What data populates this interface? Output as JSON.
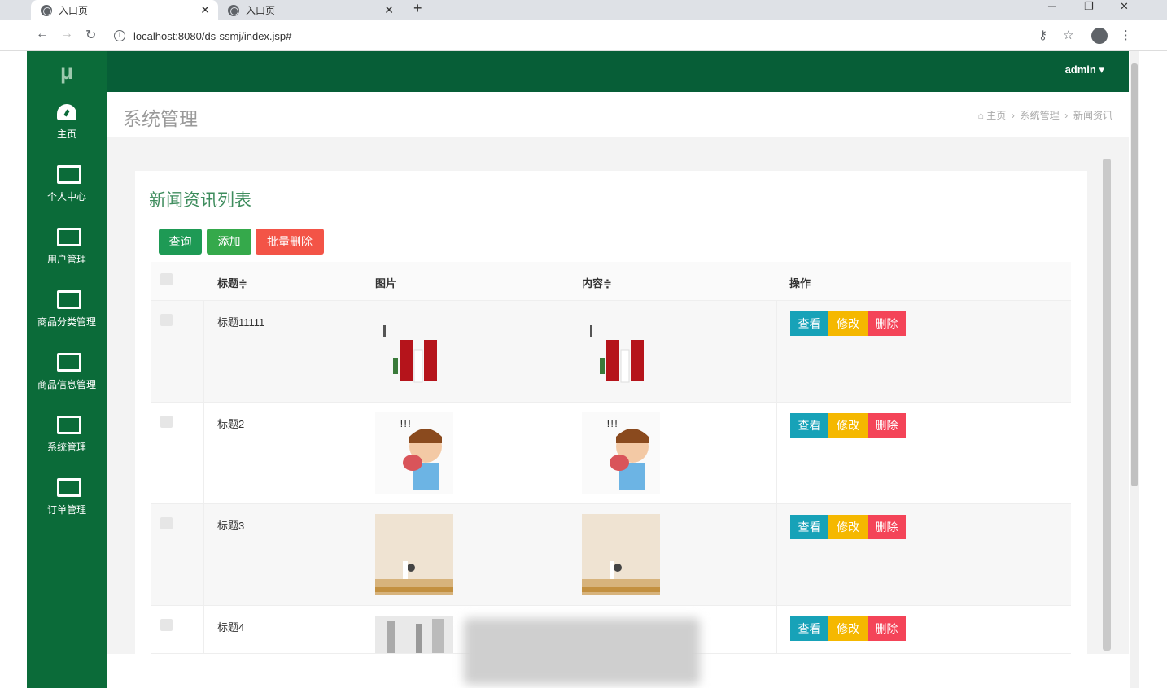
{
  "browser": {
    "tabs": [
      {
        "title": "入口页",
        "active": true
      },
      {
        "title": "入口页",
        "active": false
      }
    ],
    "url": "localhost:8080/ds-ssmj/index.jsp#",
    "new_tab": "+",
    "window_controls": {
      "minimize": "─",
      "restore": "❐",
      "close": "✕"
    }
  },
  "sidebar": {
    "logo": "μ",
    "items": [
      {
        "label": "主页",
        "icon": "dashboard-icon"
      },
      {
        "label": "个人中心",
        "icon": "monitor-icon"
      },
      {
        "label": "用户管理",
        "icon": "monitor-icon"
      },
      {
        "label": "商品分类管理",
        "icon": "monitor-icon"
      },
      {
        "label": "商品信息管理",
        "icon": "monitor-icon"
      },
      {
        "label": "系统管理",
        "icon": "monitor-icon"
      },
      {
        "label": "订单管理",
        "icon": "monitor-icon"
      }
    ]
  },
  "header": {
    "user": "admin ▾"
  },
  "page": {
    "title": "系统管理",
    "breadcrumb": [
      "主页",
      "系统管理",
      "新闻资讯"
    ]
  },
  "list": {
    "title": "新闻资讯列表",
    "buttons": {
      "search": "查询",
      "add": "添加",
      "batch_delete": "批量删除"
    },
    "columns": [
      "标题≑",
      "图片",
      "内容≑",
      "操作"
    ],
    "rows": [
      {
        "title": "标题11111"
      },
      {
        "title": "标题2"
      },
      {
        "title": "标题3"
      },
      {
        "title": "标题4"
      }
    ],
    "actions": {
      "view": "查看",
      "edit": "修改",
      "delete": "删除"
    }
  },
  "colors": {
    "sidebar": "#0b6b39",
    "topnav": "#075e37",
    "view": "#17a2b8",
    "edit": "#f5b800",
    "delete": "#f44458",
    "search": "#1e9a55",
    "add": "#35a94b",
    "batch": "#f35447"
  }
}
